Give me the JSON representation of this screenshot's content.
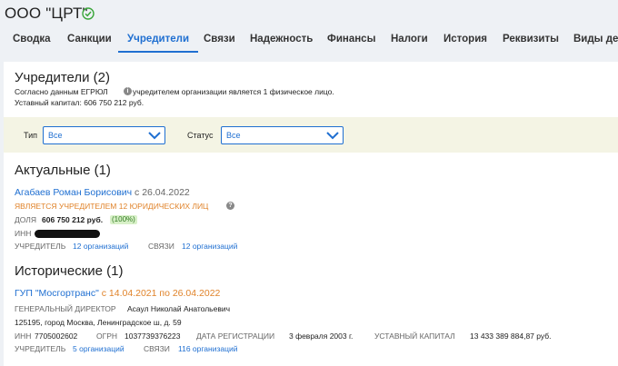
{
  "header": {
    "company": "ООО \"ЦРТ\""
  },
  "tabs": [
    {
      "label": "Сводка"
    },
    {
      "label": "Санкции"
    },
    {
      "label": "Учредители",
      "active": true
    },
    {
      "label": "Связи"
    },
    {
      "label": "Надежность"
    },
    {
      "label": "Финансы"
    },
    {
      "label": "Налоги"
    },
    {
      "label": "История"
    },
    {
      "label": "Реквизиты"
    },
    {
      "label": "Виды дея"
    }
  ],
  "founders": {
    "title": "Учредители (2)",
    "line1_a": "Согласно данным ЕГРЮЛ",
    "line1_b": "учредителем организации является 1 физическое лицо.",
    "line2": "Уставный капитал: 606 750 212 руб."
  },
  "filters": {
    "type_label": "Тип",
    "type_value": "Все",
    "status_label": "Статус",
    "status_value": "Все"
  },
  "current": {
    "title": "Актуальные (1)",
    "person": {
      "name": "Агабаев Роман Борисович",
      "since": "с 26.04.2022",
      "founder_note": "Является учредителем 12 юридических лиц",
      "share_label": "Доля",
      "share_value": "606 750 212 руб.",
      "share_pct": "(100%)",
      "inn_label": "ИНН",
      "founder_label": "Учредитель",
      "founder_link": "12 организаций",
      "links_label": "Связи",
      "links_link": "12 организаций"
    }
  },
  "historical": {
    "title": "Исторические (1)",
    "org": {
      "name": "ГУП \"Мосгортранс\"",
      "period": "с 14.04.2021 по 26.04.2022",
      "director_label": "Генеральный директор",
      "director_name": "Асаул Николай Анатольевич",
      "address": "125195, город Москва, Ленинградское ш, д. 59",
      "inn_label": "ИНН",
      "inn_value": "7705002602",
      "ogrn_label": "ОГРН",
      "ogrn_value": "1037739376223",
      "reg_label": "Дата регистрации",
      "reg_value": "3 февраля 2003 г.",
      "capital_label": "Уставный капитал",
      "capital_value": "13 433 389 884,87 руб.",
      "founder_label": "Учредитель",
      "founder_link": "5 организаций",
      "links_label": "Связи",
      "links_link": "116 организаций"
    }
  },
  "colors": {
    "accent": "#1f6fd1",
    "orange": "#e0832a",
    "filter_bg": "#f4f4e4",
    "badge_bg": "#d8f0c8"
  }
}
